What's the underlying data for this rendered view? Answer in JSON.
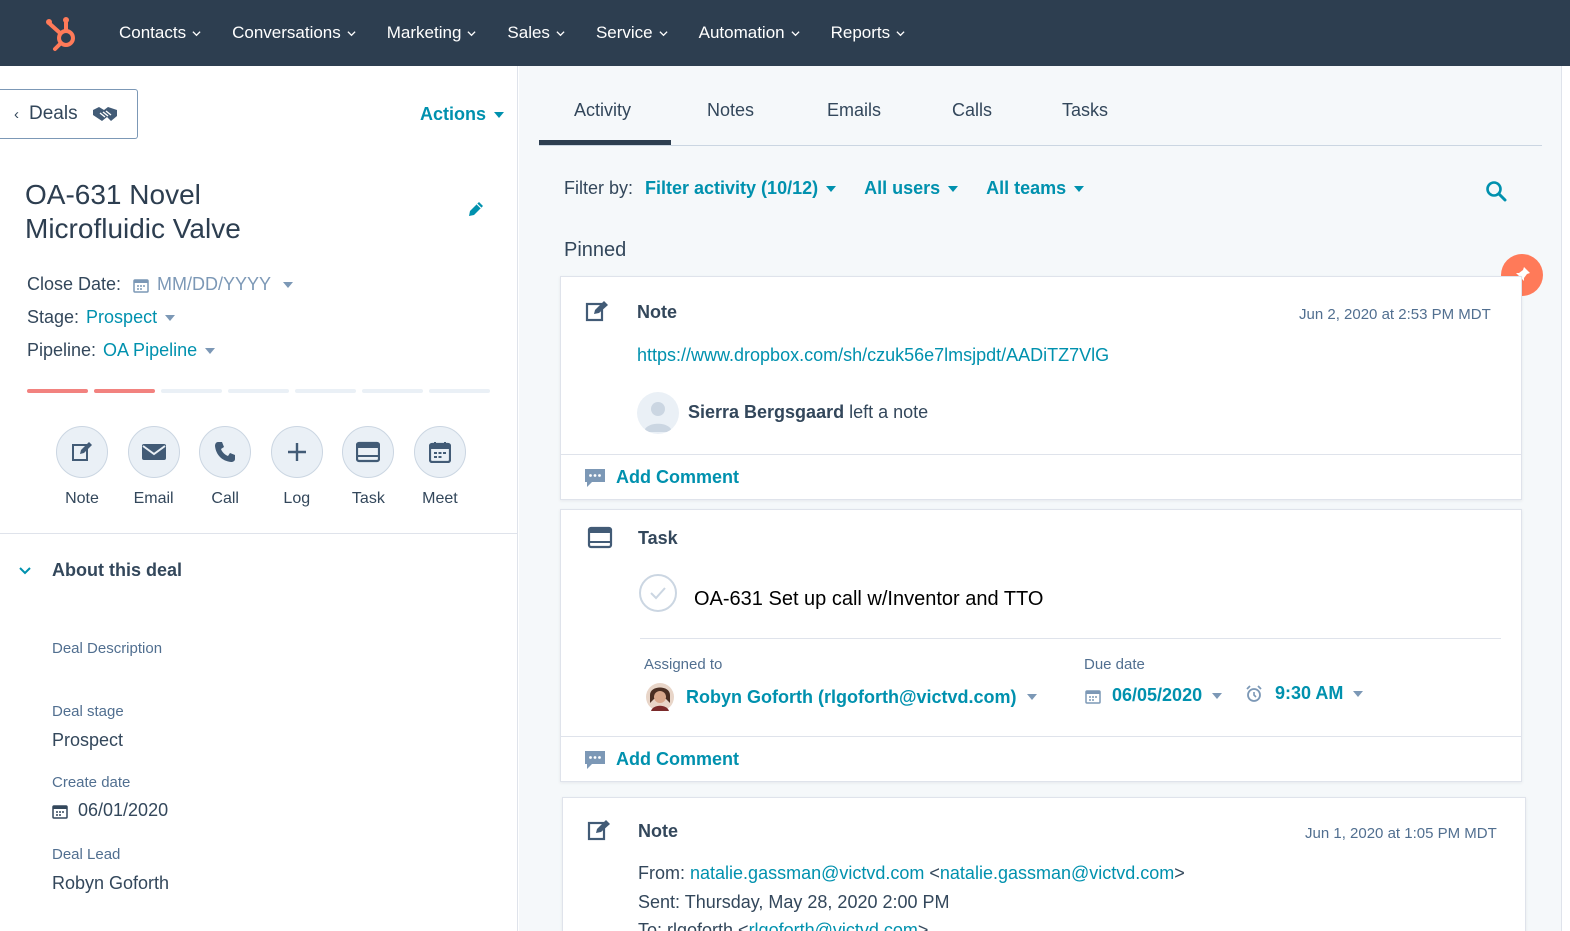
{
  "nav": {
    "items": [
      "Contacts",
      "Conversations",
      "Marketing",
      "Sales",
      "Service",
      "Automation",
      "Reports"
    ]
  },
  "left": {
    "back_label": "Deals",
    "actions_label": "Actions",
    "deal_title_line1": "OA-631 Novel",
    "deal_title_line2": "Microfluidic Valve",
    "close_date_label": "Close Date:",
    "close_date_placeholder": "MM/DD/YYYY",
    "stage_label": "Stage:",
    "stage_value": "Prospect",
    "pipeline_label": "Pipeline:",
    "pipeline_value": "OA Pipeline",
    "progress_steps_total": 7,
    "progress_steps_done": 2,
    "activity_buttons": [
      "Note",
      "Email",
      "Call",
      "Log",
      "Task",
      "Meet"
    ],
    "about_heading": "About this deal",
    "fields": {
      "description_label": "Deal Description",
      "stage_label": "Deal stage",
      "stage_value": "Prospect",
      "create_label": "Create date",
      "create_value": "06/01/2020",
      "lead_label": "Deal Lead",
      "lead_value": "Robyn Goforth"
    }
  },
  "right": {
    "tabs": [
      "Activity",
      "Notes",
      "Emails",
      "Calls",
      "Tasks"
    ],
    "active_tab": "Activity",
    "filter_label": "Filter by:",
    "filter_activity": "Filter activity (10/12)",
    "filter_users": "All users",
    "filter_teams": "All teams",
    "pinned_heading": "Pinned",
    "note1": {
      "type": "Note",
      "timestamp": "Jun 2, 2020 at 2:53 PM MDT",
      "link": "https://www.dropbox.com/sh/czuk56e7lmsjpdt/AADiTZ7VlG",
      "author": "Sierra Bergsgaard",
      "action": "left a note",
      "comment_label": "Add Comment"
    },
    "task": {
      "type": "Task",
      "title": "OA-631 Set up call w/Inventor and TTO",
      "assigned_label": "Assigned to",
      "assigned_value": "Robyn Goforth (rlgoforth@victvd.com)",
      "due_label": "Due date",
      "due_date": "06/05/2020",
      "due_time": "9:30 AM",
      "comment_label": "Add Comment"
    },
    "note2": {
      "type": "Note",
      "timestamp": "Jun 1, 2020 at 1:05 PM MDT",
      "from_label": "From:",
      "from_email": "natalie.gassman@victvd.com",
      "from_email2": "natalie.gassman@victvd.com",
      "sent_line": "Sent: Thursday, May 28, 2020 2:00 PM",
      "to_label": "To: rlgoforth <",
      "to_email": "rlgoforth@victvd.com",
      "to_suffix": ">"
    }
  },
  "colors": {
    "nav_bg": "#2d3e50",
    "accent": "#0091ae",
    "logo": "#ff7a59",
    "progress_on": "#f2827f"
  }
}
